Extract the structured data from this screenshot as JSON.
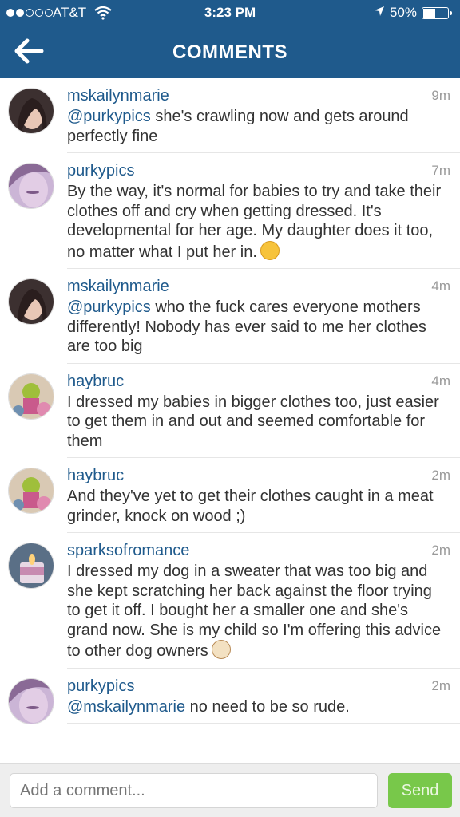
{
  "status_bar": {
    "carrier": "AT&T",
    "time": "3:23 PM",
    "battery": "50%",
    "signal_filled": 2,
    "signal_total": 5,
    "battery_level": 0.5
  },
  "header": {
    "title": "COMMENTS",
    "back_icon": "arrow-left-icon",
    "background": "#1f5a8c"
  },
  "comments": [
    {
      "user": "mskailynmarie",
      "time": "9m",
      "mention": "@purkypics",
      "text": " she's crawling now and gets around perfectly fine"
    },
    {
      "user": "purkypics",
      "time": "7m",
      "mention": "",
      "text": "By the way, it's normal for babies to try and take their clothes off and cry when getting dressed. It's developmental for her age. My daughter does it too, no matter what I put her in.",
      "emoji": "wink-emoji"
    },
    {
      "user": "mskailynmarie",
      "time": "4m",
      "mention": "@purkypics",
      "text": " who the fuck cares everyone mothers differently! Nobody has ever said to me her clothes are too big"
    },
    {
      "user": "haybruc",
      "time": "4m",
      "mention": "",
      "text": "I dressed my babies in bigger clothes too, just easier to get them in and out and seemed comfortable for them"
    },
    {
      "user": "haybruc",
      "time": "2m",
      "mention": "",
      "text": "And they've yet to get their clothes caught in a meat grinder, knock on wood ;)"
    },
    {
      "user": "sparksofromance",
      "time": "2m",
      "mention": "",
      "text": "I dressed my dog in a sweater that was too big and she kept scratching her back against the floor trying to get it off. I bought her a smaller one and she's grand now. She is my child so I'm offering this advice to other dog owners",
      "emoji": "dog-emoji"
    },
    {
      "user": "purkypics",
      "time": "2m",
      "mention": "@mskailynmarie",
      "text": " no need to be so rude."
    }
  ],
  "composer": {
    "placeholder": "Add a comment...",
    "send_label": "Send",
    "send_color": "#78c84a"
  }
}
